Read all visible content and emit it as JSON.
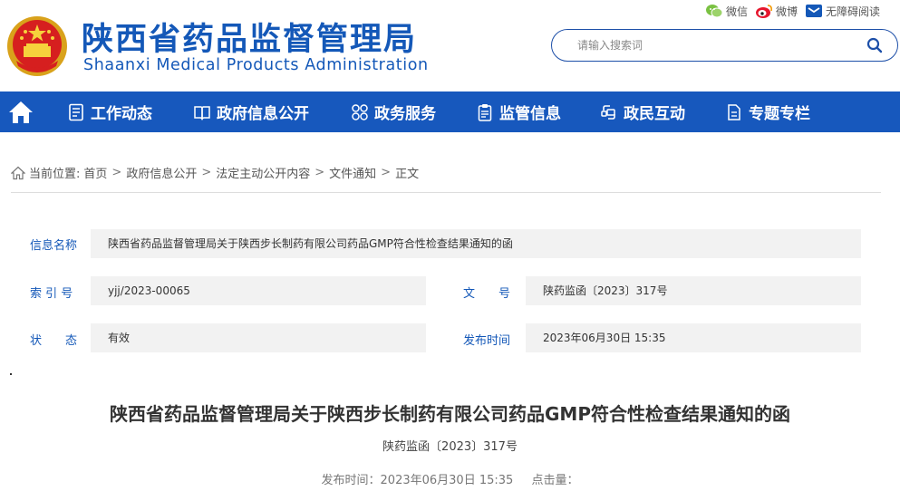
{
  "header": {
    "title_cn": "陕西省药品监督管理局",
    "title_en": "Shaanxi Medical Products Administration",
    "links": [
      {
        "label": "微信",
        "icon": "wechat-icon"
      },
      {
        "label": "微博",
        "icon": "weibo-icon"
      },
      {
        "label": "无障碍阅读",
        "icon": "accessibility-icon"
      }
    ],
    "search_placeholder": "请输入搜索词"
  },
  "nav": {
    "items": [
      {
        "label": "工作动态",
        "icon": "list-icon"
      },
      {
        "label": "政府信息公开",
        "icon": "book-icon"
      },
      {
        "label": "政务服务",
        "icon": "grid-icon"
      },
      {
        "label": "监管信息",
        "icon": "clipboard-icon"
      },
      {
        "label": "政民互动",
        "icon": "interaction-icon"
      },
      {
        "label": "专题专栏",
        "icon": "document-icon"
      }
    ]
  },
  "breadcrumb": {
    "prefix": "当前位置:",
    "items": [
      "首页",
      "政府信息公开",
      "法定主动公开内容",
      "文件通知",
      "正文"
    ]
  },
  "info": {
    "name_label": "信息名称",
    "name_value": "陕西省药品监督管理局关于陕西步长制药有限公司药品GMP符合性检查结果通知的函",
    "index_label": "索 引 号",
    "index_value": "yjj/2023-00065",
    "doc_label": "文　　号",
    "doc_value": "陕药监函〔2023〕317号",
    "status_label": "状　　态",
    "status_value": "有效",
    "date_label": "发布时间",
    "date_value": "2023年06月30日 15:35"
  },
  "article": {
    "title": "陕西省药品监督管理局关于陕西步长制药有限公司药品GMP符合性检查结果通知的函",
    "doc_no": "陕药监函〔2023〕317号",
    "publish": "发布时间：2023年06月30日 15:35",
    "clicks": "点击量："
  },
  "colors": {
    "brand": "#1458b8",
    "nav_bg": "#1758bd",
    "field_bg": "#f2f2f2"
  }
}
